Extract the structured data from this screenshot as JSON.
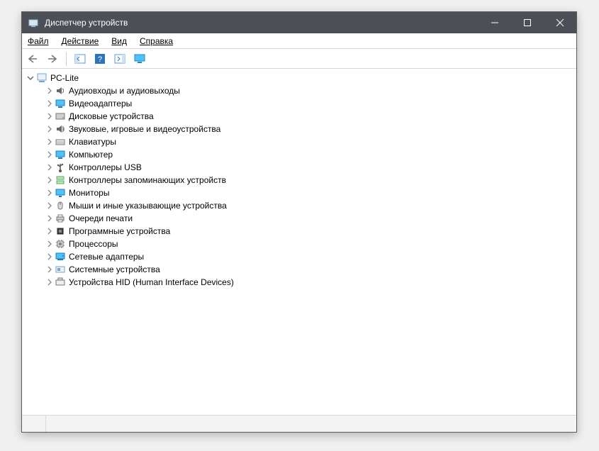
{
  "window": {
    "title": "Диспетчер устройств"
  },
  "menu": {
    "file": "Файл",
    "action": "Действие",
    "view": "Вид",
    "help": "Справка"
  },
  "root": {
    "name": "PC-Lite"
  },
  "categories": [
    {
      "icon": "audio",
      "label": "Аудиовходы и аудиовыходы"
    },
    {
      "icon": "display",
      "label": "Видеоадаптеры"
    },
    {
      "icon": "disk",
      "label": "Дисковые устройства"
    },
    {
      "icon": "sound",
      "label": "Звуковые, игровые и видеоустройства"
    },
    {
      "icon": "keyboard",
      "label": "Клавиатуры"
    },
    {
      "icon": "computer",
      "label": "Компьютер"
    },
    {
      "icon": "usb",
      "label": "Контроллеры USB"
    },
    {
      "icon": "storage",
      "label": "Контроллеры запоминающих устройств"
    },
    {
      "icon": "monitor",
      "label": "Мониторы"
    },
    {
      "icon": "mouse",
      "label": "Мыши и иные указывающие устройства"
    },
    {
      "icon": "printer",
      "label": "Очереди печати"
    },
    {
      "icon": "firmware",
      "label": "Программные устройства"
    },
    {
      "icon": "cpu",
      "label": "Процессоры"
    },
    {
      "icon": "network",
      "label": "Сетевые адаптеры"
    },
    {
      "icon": "system",
      "label": "Системные устройства"
    },
    {
      "icon": "hid",
      "label": "Устройства HID (Human Interface Devices)"
    }
  ]
}
